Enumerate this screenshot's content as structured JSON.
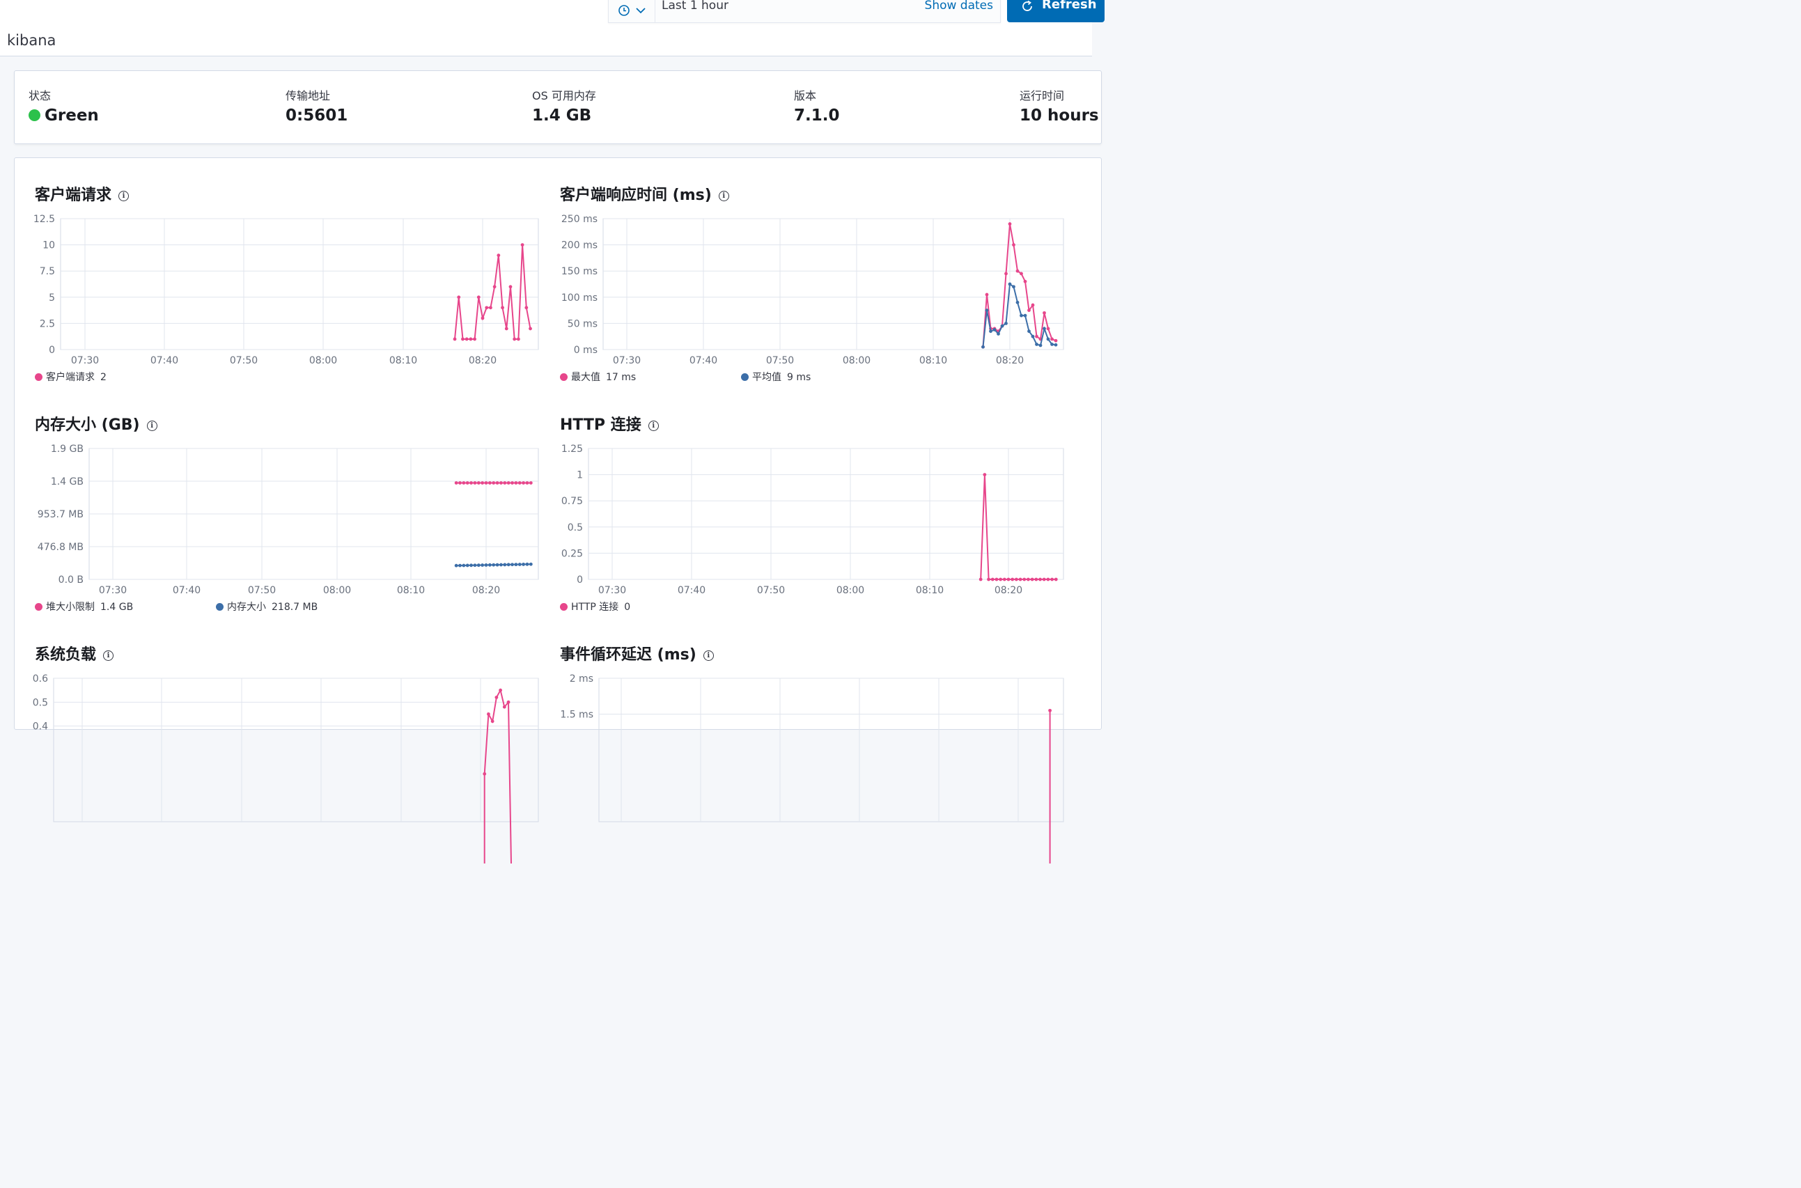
{
  "header": {
    "app_title": "kibana",
    "time_range_label": "Last 1 hour",
    "show_dates_label": "Show dates",
    "refresh_label": "Refresh"
  },
  "status": [
    {
      "label": "状态",
      "value": "Green",
      "indicator_color": "#2cc14b"
    },
    {
      "label": "传输地址",
      "value": "0:5601"
    },
    {
      "label": "OS 可用内存",
      "value": "1.4 GB"
    },
    {
      "label": "版本",
      "value": "7.1.0"
    },
    {
      "label": "运行时间",
      "value": "10 hours"
    }
  ],
  "colors": {
    "pink": "#e7468b",
    "blue": "#3c6ea8",
    "accent": "#006bb4"
  },
  "chart_data": [
    {
      "type": "line",
      "title": "客户端请求",
      "x_ticks": [
        "07:30",
        "07:40",
        "07:50",
        "08:00",
        "08:10",
        "08:20"
      ],
      "y_ticks": [
        "12.5",
        "10",
        "7.5",
        "5",
        "2.5",
        "0"
      ],
      "ylim": [
        0,
        12.5
      ],
      "series": [
        {
          "name": "客户端请求",
          "color": "#e7468b",
          "legend_value": "2",
          "x": [
            "08:16:30",
            "08:17:00",
            "08:17:30",
            "08:18:00",
            "08:18:30",
            "08:19:00",
            "08:19:30",
            "08:20:00",
            "08:20:30",
            "08:21:00",
            "08:21:30",
            "08:22:00",
            "08:22:30",
            "08:23:00",
            "08:23:30",
            "08:24:00",
            "08:24:30",
            "08:25:00",
            "08:25:30",
            "08:26:00"
          ],
          "values": [
            1,
            5,
            1,
            1,
            1,
            1,
            5,
            3,
            4,
            4,
            6,
            9,
            4,
            2,
            6,
            1,
            1,
            10,
            4,
            2
          ]
        }
      ]
    },
    {
      "type": "line",
      "title": "客户端响应时间 (ms)",
      "x_ticks": [
        "07:30",
        "07:40",
        "07:50",
        "08:00",
        "08:10",
        "08:20"
      ],
      "y_ticks": [
        "250 ms",
        "200 ms",
        "150 ms",
        "100 ms",
        "50 ms",
        "0 ms"
      ],
      "ylim": [
        0,
        250
      ],
      "series": [
        {
          "name": "最大值",
          "color": "#e7468b",
          "legend_value": "17 ms",
          "x": [
            "08:16:30",
            "08:17:00",
            "08:17:30",
            "08:18:00",
            "08:18:30",
            "08:19:00",
            "08:19:30",
            "08:20:00",
            "08:20:30",
            "08:21:00",
            "08:21:30",
            "08:22:00",
            "08:22:30",
            "08:23:00",
            "08:23:30",
            "08:24:00",
            "08:24:30",
            "08:25:00",
            "08:25:30",
            "08:26:00"
          ],
          "values": [
            5,
            105,
            40,
            40,
            35,
            45,
            145,
            240,
            200,
            150,
            145,
            130,
            75,
            85,
            25,
            20,
            70,
            40,
            20,
            17
          ]
        },
        {
          "name": "平均值",
          "color": "#3c6ea8",
          "legend_value": "9 ms",
          "x": [
            "08:16:30",
            "08:17:00",
            "08:17:30",
            "08:18:00",
            "08:18:30",
            "08:19:00",
            "08:19:30",
            "08:20:00",
            "08:20:30",
            "08:21:00",
            "08:21:30",
            "08:22:00",
            "08:22:30",
            "08:23:00",
            "08:23:30",
            "08:24:00",
            "08:24:30",
            "08:25:00",
            "08:25:30",
            "08:26:00"
          ],
          "values": [
            5,
            75,
            35,
            38,
            30,
            45,
            50,
            125,
            120,
            90,
            65,
            65,
            35,
            25,
            10,
            8,
            40,
            20,
            10,
            9
          ]
        }
      ]
    },
    {
      "type": "line",
      "title": "内存大小 (GB)",
      "x_ticks": [
        "07:30",
        "07:40",
        "07:50",
        "08:00",
        "08:10",
        "08:20"
      ],
      "y_ticks": [
        "1.9 GB",
        "1.4 GB",
        "953.7 MB",
        "476.8 MB",
        "0.0 B"
      ],
      "ylim": [
        0,
        1.9
      ],
      "series": [
        {
          "name": "堆大小限制",
          "color": "#e7468b",
          "legend_value": "1.4 GB",
          "x": [
            "08:16:00",
            "08:16:30",
            "08:17:00",
            "08:17:30",
            "08:18:00",
            "08:18:30",
            "08:19:00",
            "08:19:30",
            "08:20:00",
            "08:20:30",
            "08:21:00",
            "08:21:30",
            "08:22:00",
            "08:22:30",
            "08:23:00",
            "08:23:30",
            "08:24:00",
            "08:24:30",
            "08:25:00",
            "08:25:30",
            "08:26:00"
          ],
          "values": [
            1.4,
            1.4,
            1.4,
            1.4,
            1.4,
            1.4,
            1.4,
            1.4,
            1.4,
            1.4,
            1.4,
            1.4,
            1.4,
            1.4,
            1.4,
            1.4,
            1.4,
            1.4,
            1.4,
            1.4,
            1.4
          ]
        },
        {
          "name": "内存大小",
          "color": "#3c6ea8",
          "legend_value": "218.7 MB",
          "x": [
            "08:16:00",
            "08:16:30",
            "08:17:00",
            "08:17:30",
            "08:18:00",
            "08:18:30",
            "08:19:00",
            "08:19:30",
            "08:20:00",
            "08:20:30",
            "08:21:00",
            "08:21:30",
            "08:22:00",
            "08:22:30",
            "08:23:00",
            "08:23:30",
            "08:24:00",
            "08:24:30",
            "08:25:00",
            "08:25:30",
            "08:26:00"
          ],
          "values": [
            0.2,
            0.201,
            0.202,
            0.203,
            0.204,
            0.205,
            0.206,
            0.207,
            0.208,
            0.209,
            0.21,
            0.211,
            0.212,
            0.213,
            0.214,
            0.215,
            0.216,
            0.217,
            0.218,
            0.219,
            0.22
          ]
        }
      ]
    },
    {
      "type": "line",
      "title": "HTTP 连接",
      "x_ticks": [
        "07:30",
        "07:40",
        "07:50",
        "08:00",
        "08:10",
        "08:20"
      ],
      "y_ticks": [
        "1.25",
        "1",
        "0.75",
        "0.5",
        "0.25",
        "0"
      ],
      "ylim": [
        0,
        1.25
      ],
      "series": [
        {
          "name": "HTTP 连接",
          "color": "#e7468b",
          "legend_value": "0",
          "x": [
            "08:16:30",
            "08:17:00",
            "08:17:30",
            "08:18:00",
            "08:18:30",
            "08:19:00",
            "08:19:30",
            "08:20:00",
            "08:20:30",
            "08:21:00",
            "08:21:30",
            "08:22:00",
            "08:22:30",
            "08:23:00",
            "08:23:30",
            "08:24:00",
            "08:24:30",
            "08:25:00",
            "08:25:30",
            "08:26:00"
          ],
          "values": [
            0,
            1,
            0,
            0,
            0,
            0,
            0,
            0,
            0,
            0,
            0,
            0,
            0,
            0,
            0,
            0,
            0,
            0,
            0,
            0
          ]
        }
      ]
    },
    {
      "type": "line",
      "title": "系统负载",
      "y_ticks": [
        "0.6",
        "0.5",
        "0.4"
      ],
      "ylim": [
        0,
        0.6
      ],
      "series": [
        {
          "color": "#e7468b",
          "x": [
            "08:20:30",
            "08:21:00",
            "08:21:30",
            "08:22:00",
            "08:22:30",
            "08:23:00",
            "08:23:30"
          ],
          "values": [
            0.2,
            0.45,
            0.42,
            0.52,
            0.55,
            0.48,
            0.5
          ]
        }
      ]
    },
    {
      "type": "line",
      "title": "事件循环延迟 (ms)",
      "y_ticks": [
        "2 ms",
        "1.5 ms"
      ],
      "ylim": [
        0,
        2
      ],
      "series": [
        {
          "color": "#e7468b",
          "x": [
            "08:24:00"
          ],
          "values": [
            1.55
          ]
        }
      ]
    }
  ]
}
